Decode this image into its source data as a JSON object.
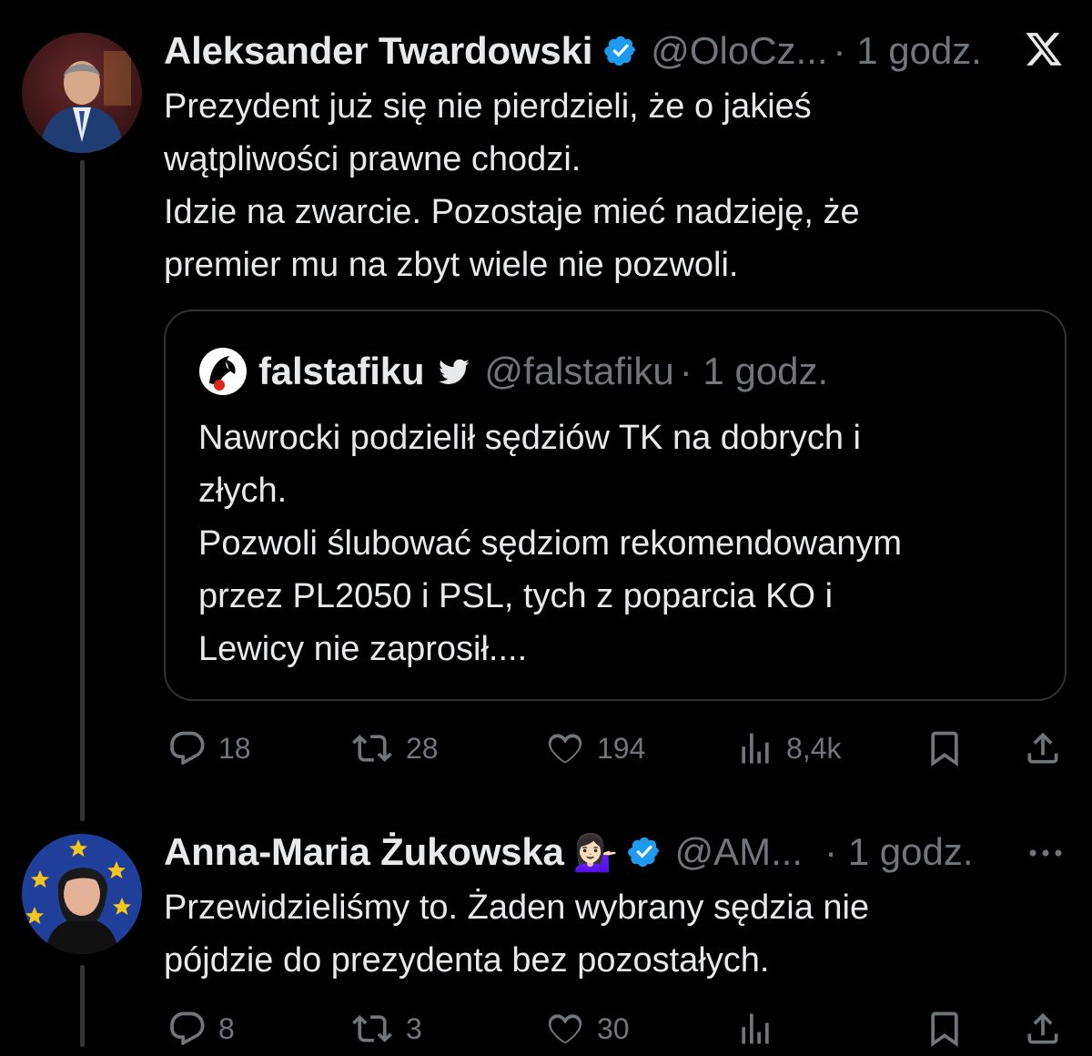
{
  "tweet1": {
    "author_name": "Aleksander Twardowski",
    "handle": "@OloCz...",
    "time": "· 1 godz.",
    "body_lines": [
      "Prezydent już się nie pierdzieli, że o jakieś",
      "wątpliwości prawne chodzi.",
      "Idzie na zwarcie. Pozostaje mieć nadzieję, że",
      "premier mu na zbyt wiele nie pozwoli."
    ],
    "quote": {
      "author_name": "falstafiku",
      "handle": "@falstafiku",
      "time": "· 1 godz.",
      "body_lines": [
        "Nawrocki podzielił sędziów TK na dobrych i",
        "złych.",
        "Pozwoli ślubować sędziom rekomendowanym",
        "przez PL2050 i PSL, tych z poparcia KO i",
        "Lewicy nie zaprosił...."
      ]
    },
    "actions": {
      "replies": "18",
      "reposts": "28",
      "likes": "194",
      "views": "8,4k"
    }
  },
  "tweet2": {
    "author_name": "Anna-Maria Żukowska",
    "emoji": "💁🏻‍♀️",
    "handle": "@AM...",
    "time": "· 1 godz.",
    "body_lines": [
      "Przewidzieliśmy to. Żaden wybrany sędzia nie",
      "pójdzie do prezydenta bez pozostałych."
    ],
    "actions": {
      "replies": "8",
      "reposts": "3",
      "likes": "30"
    }
  },
  "icons": [
    "verified-icon",
    "x-logo-icon",
    "twitter-bird-icon",
    "reply-icon",
    "repost-icon",
    "like-icon",
    "views-icon",
    "bookmark-icon",
    "share-icon",
    "more-icon"
  ],
  "colors": {
    "background": "#000000",
    "text": "#e7e9ea",
    "muted": "#71767b",
    "verified": "#1d9bf0",
    "border": "#2f3336"
  }
}
